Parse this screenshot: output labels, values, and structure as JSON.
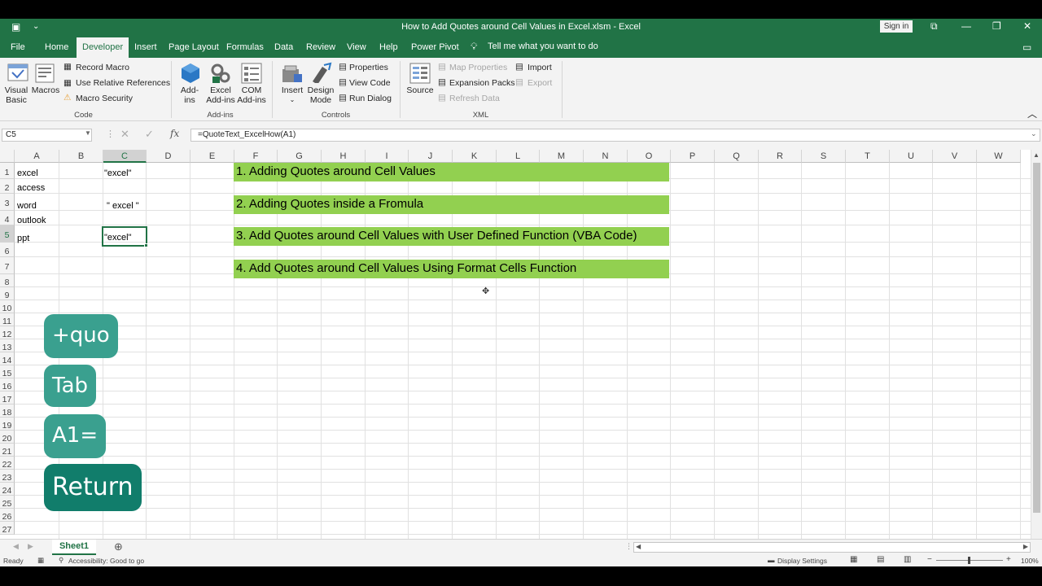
{
  "window": {
    "title": "How to Add Quotes around Cell Values in Excel.xlsm  -  Excel",
    "signin": "Sign in"
  },
  "tabs": [
    "File",
    "Home",
    "Developer",
    "Insert",
    "Page Layout",
    "Formulas",
    "Data",
    "Review",
    "View",
    "Help",
    "Power Pivot"
  ],
  "active_tab": "Developer",
  "tellme": "Tell me what you want to do",
  "ribbon": {
    "code": {
      "visual_basic": "Visual Basic",
      "macros": "Macros",
      "record_macro": "Record Macro",
      "relative_refs": "Use Relative References",
      "macro_security": "Macro Security",
      "label": "Code"
    },
    "addins": {
      "addins": "Add-ins",
      "excel_addins": "Excel Add-ins",
      "com_addins": "COM Add-ins",
      "label": "Add-ins"
    },
    "controls": {
      "insert": "Insert",
      "design_mode": "Design Mode",
      "properties": "Properties",
      "view_code": "View Code",
      "run_dialog": "Run Dialog",
      "label": "Controls"
    },
    "xml": {
      "source": "Source",
      "map_properties": "Map Properties",
      "expansion_packs": "Expansion Packs",
      "refresh_data": "Refresh Data",
      "import": "Import",
      "export": "Export",
      "label": "XML"
    }
  },
  "formula_bar": {
    "name_box": "C5",
    "formula": "=QuoteText_ExcelHow(A1)",
    "fx": "fx"
  },
  "columns": [
    "A",
    "B",
    "C",
    "D",
    "E",
    "F",
    "G",
    "H",
    "I",
    "J",
    "K",
    "L",
    "M",
    "N",
    "O",
    "P",
    "Q",
    "R",
    "S",
    "T",
    "U",
    "V",
    "W"
  ],
  "rows": [
    "1",
    "2",
    "3",
    "4",
    "5",
    "6",
    "7",
    "8",
    "9",
    "10",
    "11",
    "12",
    "13",
    "14",
    "15",
    "16",
    "17",
    "18",
    "19",
    "20",
    "21",
    "22",
    "23",
    "24",
    "25",
    "26",
    "27"
  ],
  "cells": {
    "A1": "excel",
    "A2": "access",
    "A3": "word",
    "A4": "outlook",
    "A5": "ppt",
    "C1": "\"excel\"",
    "C3": "\" excel \"",
    "C5": "\"excel\""
  },
  "bands": [
    "1. Adding Quotes around Cell Values",
    "2. Adding Quotes inside a Fromula",
    "3. Add Quotes around Cell Values with User Defined Function (VBA Code)",
    "4. Add Quotes around Cell Values Using Format Cells Function"
  ],
  "key_overlays": [
    "+quo",
    "Tab",
    "A1=",
    "Return"
  ],
  "sheet_tab": "Sheet1",
  "status": {
    "ready": "Ready",
    "accessibility": "Accessibility: Good to go",
    "display_settings": "Display Settings",
    "zoom": "100%"
  },
  "colors": {
    "accent": "#217346",
    "band": "#92d050",
    "overlay": "#3aa08f"
  }
}
